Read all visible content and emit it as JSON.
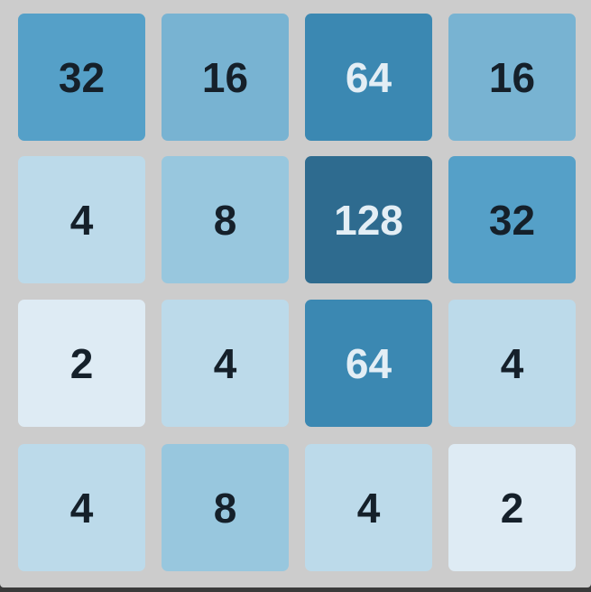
{
  "board": {
    "colors": {
      "background": "#cccccc",
      "text_dark": "#15202a",
      "text_light": "#e3eef5",
      "tile_2": "#deebf4",
      "tile_4": "#bcdaea",
      "tile_8": "#98c7de",
      "tile_16": "#78b3d2",
      "tile_32": "#55a0c8",
      "tile_64": "#3b88b2",
      "tile_128": "#2e6b8f"
    },
    "rows": [
      [
        32,
        16,
        64,
        16
      ],
      [
        4,
        8,
        128,
        32
      ],
      [
        2,
        4,
        64,
        4
      ],
      [
        4,
        8,
        4,
        2
      ]
    ]
  }
}
